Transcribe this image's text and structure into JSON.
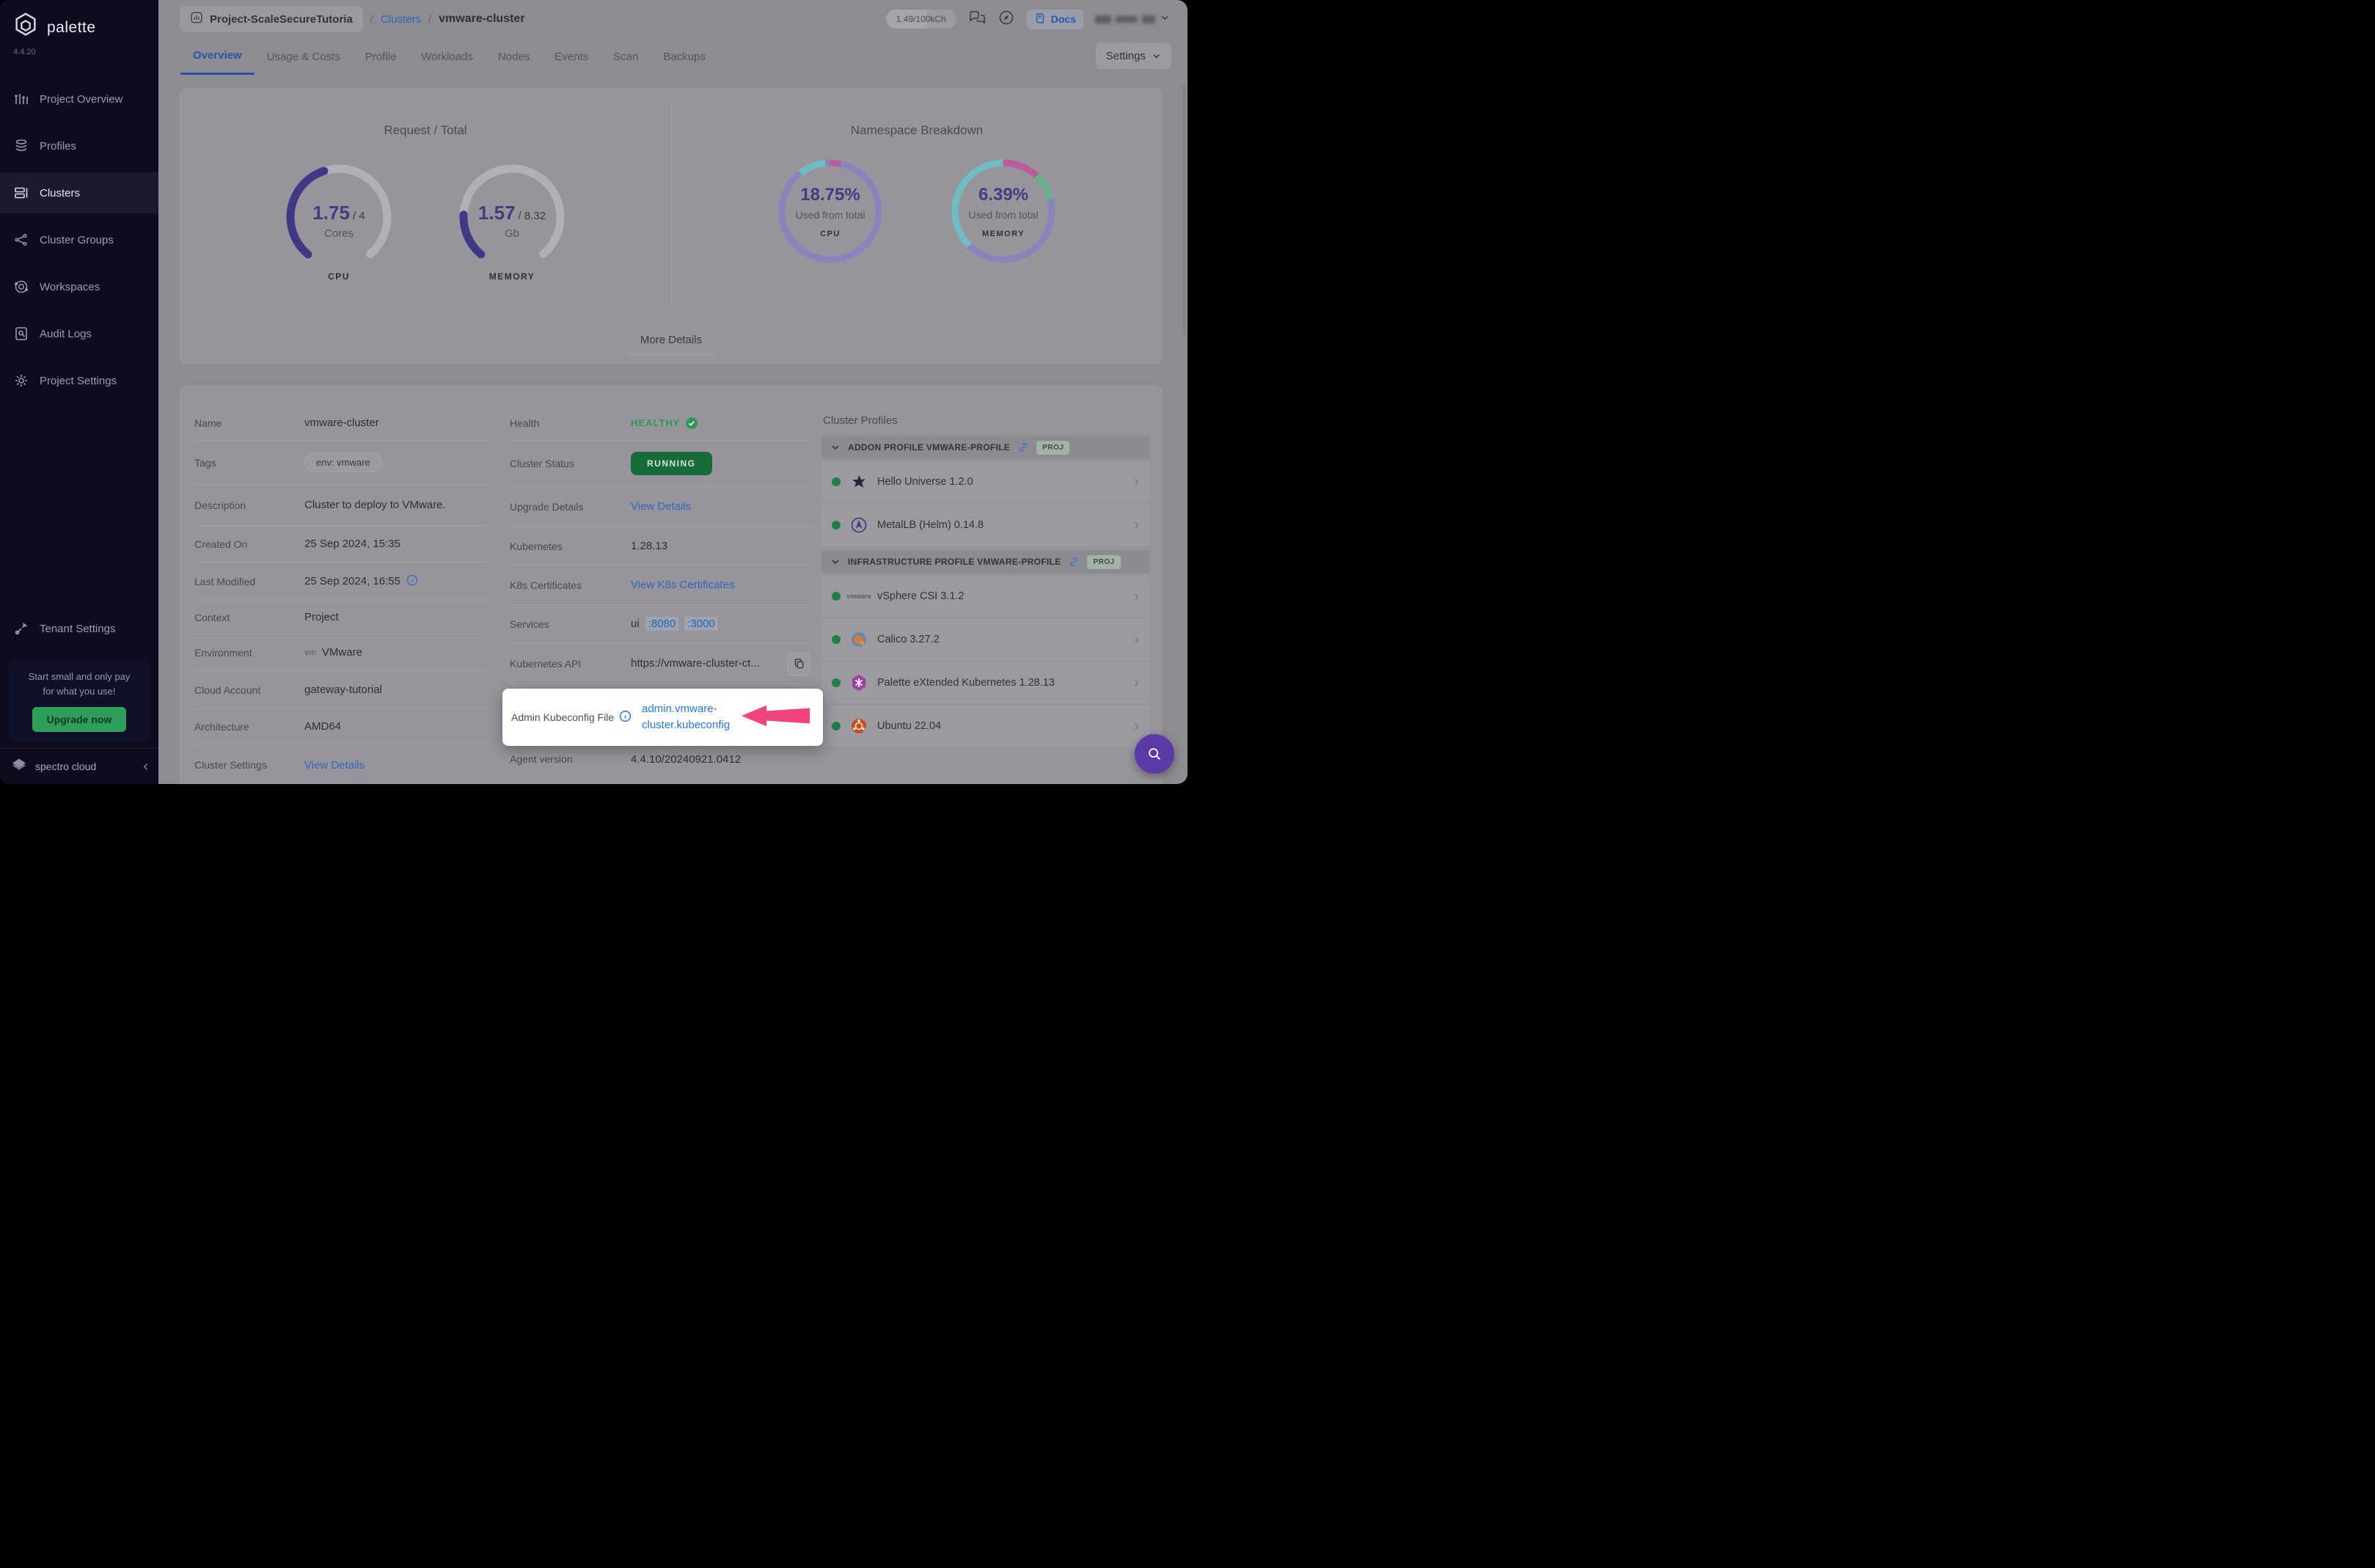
{
  "colors": {
    "accent_blue": "#2e66bd",
    "link_bright": "#2878e8",
    "status_green": "#1e8047",
    "healthy_green": "#2f9757",
    "running_green": "#156c38",
    "gauge_indigo": "#3f3985",
    "donut_purple": "#8c83bd",
    "donut_teal": "#6fbcc2",
    "donut_pink": "#b85e9b",
    "donut_green": "#68b189",
    "annotation_pink": "#f1437e",
    "sidebar_bg": "#0c0c1e",
    "fab_purple": "#5b3aa8"
  },
  "app": {
    "brand": "palette",
    "version": "4.4.20",
    "footer_brand": "spectro cloud"
  },
  "sidebar": {
    "items": [
      {
        "label": "Project Overview",
        "icon": "bar-chart-icon"
      },
      {
        "label": "Profiles",
        "icon": "layers-icon"
      },
      {
        "label": "Clusters",
        "icon": "server-icon"
      },
      {
        "label": "Cluster Groups",
        "icon": "nodes-icon"
      },
      {
        "label": "Workspaces",
        "icon": "orbit-icon"
      },
      {
        "label": "Audit Logs",
        "icon": "audit-icon"
      },
      {
        "label": "Project Settings",
        "icon": "gear-icon"
      }
    ],
    "tenant_settings": "Tenant Settings",
    "promo": {
      "line1": "Start small and only pay",
      "line2": "for what you use!",
      "cta": "Upgrade now"
    }
  },
  "header": {
    "project": "Project-ScaleSecureTutoria",
    "sep": "/",
    "breadcrumb_link": "Clusters",
    "breadcrumb_current": "vmware-cluster",
    "usage": "1.49/100kCh",
    "docs": "Docs",
    "settings": "Settings"
  },
  "tabs": {
    "active": "Overview",
    "items": [
      {
        "label": "Overview"
      },
      {
        "label": "Usage & Costs"
      },
      {
        "label": "Profile"
      },
      {
        "label": "Workloads"
      },
      {
        "label": "Nodes"
      },
      {
        "label": "Events"
      },
      {
        "label": "Scan"
      },
      {
        "label": "Backups"
      }
    ]
  },
  "overview": {
    "request_total": {
      "title": "Request / Total",
      "gauges": [
        {
          "metric": "CPU",
          "value": "1.75",
          "total_display": "/ 4",
          "unit": "Cores",
          "fraction": 0.4375,
          "track_dash": "77.8 22.2",
          "value_dash": "34 66"
        },
        {
          "metric": "MEMORY",
          "value": "1.57",
          "total_display": "/ 8.32",
          "unit": "Gb",
          "fraction": 0.1887,
          "track_dash": "77.8 22.2",
          "value_dash": "14.7 85.3"
        }
      ]
    },
    "namespace_breakdown": {
      "title": "Namespace Breakdown",
      "donuts": [
        {
          "metric": "CPU",
          "pct": "18.75%",
          "caption": "Used from total",
          "segments": {
            "pink": {
              "dash": "3.5 96.5",
              "offset": "0"
            },
            "teal": {
              "dash": "9 91",
              "offset": "-89.5"
            }
          }
        },
        {
          "metric": "MEMORY",
          "pct": "6.39%",
          "caption": "Used from total",
          "segments": {
            "pink": {
              "dash": "12 88",
              "offset": "0"
            },
            "green": {
              "dash": "9 91",
              "offset": "-12"
            },
            "teal": {
              "dash": "37.5 62.5",
              "offset": "-62.5"
            }
          }
        }
      ]
    },
    "more_details": "More Details"
  },
  "details": {
    "left": [
      {
        "label": "Name",
        "value": "vmware-cluster"
      },
      {
        "label": "Tags",
        "value": "env: vmware"
      },
      {
        "label": "Description",
        "value": "Cluster to deploy to VMware."
      },
      {
        "label": "Created On",
        "value": "25 Sep 2024, 15:35"
      },
      {
        "label": "Last Modified",
        "value": "25 Sep 2024, 16:55"
      },
      {
        "label": "Context",
        "value": "Project"
      },
      {
        "label": "Environment",
        "value": "VMware",
        "prefix": "vm"
      },
      {
        "label": "Cloud Account",
        "value": "gateway-tutorial"
      },
      {
        "label": "Architecture",
        "value": "AMD64"
      },
      {
        "label": "Cluster Settings",
        "value": "View Details"
      }
    ],
    "right": [
      {
        "label": "Health",
        "value": "HEALTHY"
      },
      {
        "label": "Cluster Status",
        "value": "RUNNING"
      },
      {
        "label": "Upgrade Details",
        "value": "View Details"
      },
      {
        "label": "Kubernetes",
        "value": "1.28.13"
      },
      {
        "label": "K8s Certificates",
        "value": "View K8s Certificates"
      },
      {
        "label": "Services",
        "value": "ui",
        "ports": [
          ":8080",
          ":3000"
        ]
      },
      {
        "label": "Kubernetes API",
        "value": "https://vmware-cluster-ct..."
      },
      {
        "label": "Agent version",
        "value": "4.4.10/20240921.0412"
      }
    ]
  },
  "spotlight": {
    "label": "Admin Kubeconfig File",
    "link_line1": "admin.vmware-",
    "link_line2": "cluster.kubeconfig"
  },
  "cluster_profiles": {
    "title": "Cluster Profiles",
    "sections": [
      {
        "header": "ADDON PROFILE VMWARE-PROFILE",
        "badge": "PROJ",
        "items": [
          {
            "name": "Hello Universe 1.2.0",
            "icon": "hello-universe-icon"
          },
          {
            "name": "MetalLB (Helm) 0.14.8",
            "icon": "metallb-icon"
          }
        ]
      },
      {
        "header": "INFRASTRUCTURE PROFILE VMWARE-PROFILE",
        "badge": "PROJ",
        "items": [
          {
            "name": "vSphere CSI 3.1.2",
            "icon": "vmware-icon"
          },
          {
            "name": "Calico 3.27.2",
            "icon": "calico-icon"
          },
          {
            "name": "Palette eXtended Kubernetes 1.28.13",
            "icon": "pxk-icon"
          },
          {
            "name": "Ubuntu 22.04",
            "icon": "ubuntu-icon"
          }
        ]
      }
    ]
  }
}
